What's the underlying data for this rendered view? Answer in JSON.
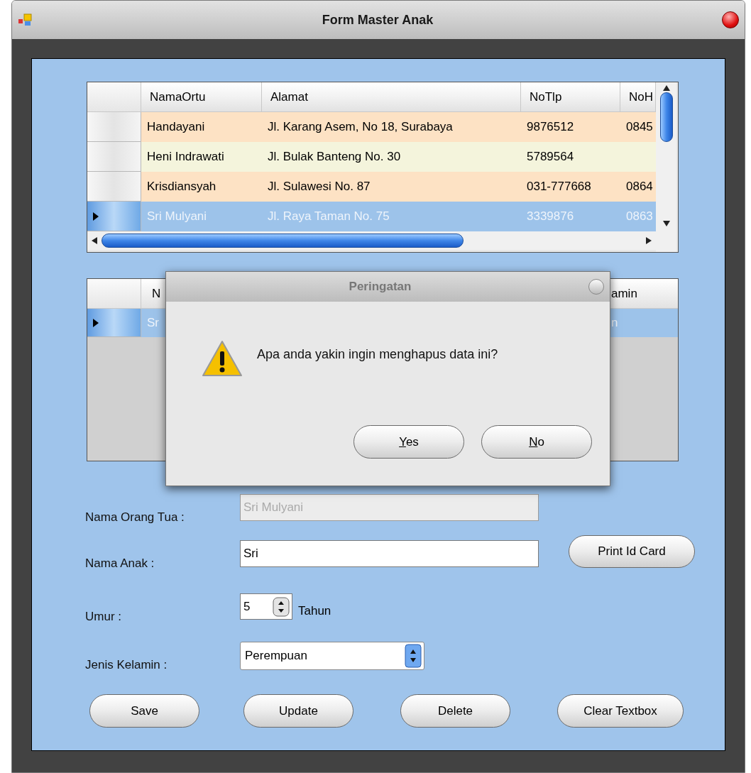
{
  "window": {
    "title": "Form Master Anak"
  },
  "grid_parent": {
    "columns": [
      "NamaOrtu",
      "Alamat",
      "NoTlp",
      "NoH"
    ],
    "rows": [
      {
        "cells": [
          "Handayani",
          "Jl. Karang Asem, No 18, Surabaya",
          "9876512",
          "0845"
        ],
        "selected": false
      },
      {
        "cells": [
          "Heni Indrawati",
          "Jl. Bulak Banteng No. 30",
          "5789564",
          ""
        ],
        "selected": false
      },
      {
        "cells": [
          "Krisdiansyah",
          "Jl. Sulawesi No. 87",
          "031-777668",
          "0864"
        ],
        "selected": false
      },
      {
        "cells": [
          "Sri Mulyani",
          "Jl. Raya Taman No. 75",
          "3339876",
          "0863"
        ],
        "selected": true
      }
    ]
  },
  "grid_child": {
    "columns": [
      "N",
      "amin"
    ],
    "rows": [
      {
        "cells": [
          "Sr",
          "n"
        ],
        "selected": true
      }
    ]
  },
  "dialog": {
    "title": "Peringatan",
    "message": "Apa anda yakin ingin menghapus data ini?",
    "buttons": [
      "Yes",
      "No"
    ]
  },
  "form": {
    "fields": [
      {
        "kind": "text",
        "label": "Nama Orang Tua :",
        "value": "Sri Mulyani",
        "disabled": true
      },
      {
        "kind": "text",
        "label": "Nama Anak :",
        "value": "Sri",
        "disabled": false
      },
      {
        "kind": "spinner",
        "label": "Umur :",
        "value": "5",
        "unit": "Tahun"
      },
      {
        "kind": "combo",
        "label": "Jenis Kelamin :",
        "value": "Perempuan"
      }
    ],
    "side_button": "Print Id Card",
    "buttons": [
      "Save",
      "Update",
      "Delete",
      "Clear Textbox"
    ]
  }
}
